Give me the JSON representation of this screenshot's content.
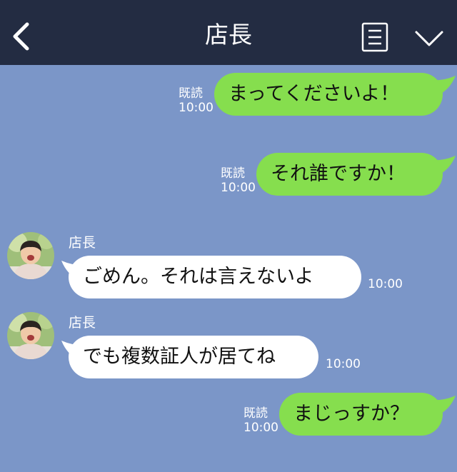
{
  "header": {
    "title": "店長",
    "back_icon": "chevron-left-icon",
    "menu_icon": "list-icon",
    "dropdown_icon": "chevron-down-icon"
  },
  "colors": {
    "header_bg": "#232c42",
    "chat_bg": "#7b96c8",
    "outgoing_bubble": "#86de4e",
    "incoming_bubble": "#ffffff"
  },
  "messages": [
    {
      "direction": "out",
      "text": "まってくださいよ！",
      "read_label": "既読",
      "time": "10:00"
    },
    {
      "direction": "out",
      "text": "それ誰ですか！",
      "read_label": "既読",
      "time": "10:00"
    },
    {
      "direction": "in",
      "sender": "店長",
      "text": "ごめん。それは言えないよ",
      "time": "10:00"
    },
    {
      "direction": "in",
      "sender": "店長",
      "text": "でも複数証人が居てね",
      "time": "10:00"
    },
    {
      "direction": "out",
      "text": "まじっすか？",
      "read_label": "既読",
      "time": "10:00"
    }
  ]
}
